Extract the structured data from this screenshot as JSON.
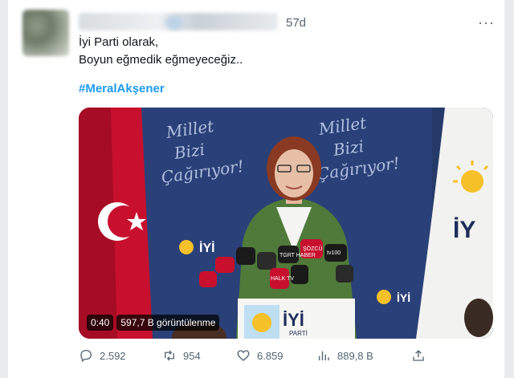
{
  "tweet": {
    "time": "57d",
    "more_label": "···",
    "lines": [
      "İyi Parti olarak,",
      "Boyun eğmedik eğmeyeceğiz.."
    ],
    "hashtag": "#MeralAkşener"
  },
  "media": {
    "banner_text": "Millet Bizi Çağırıyor!",
    "party_logo_text": "İYİ",
    "party_logo_sub": "PARTİ",
    "duration": "0:40",
    "views_label": "597,7 B görüntülenme",
    "mic_labels": [
      "TGRT HABER",
      "ŞÖZCÜ",
      "tv100",
      "HALK TV"
    ]
  },
  "actions": {
    "replies": "2.592",
    "retweets": "954",
    "likes": "6.859",
    "views": "889,8 B"
  },
  "colors": {
    "accent": "#1d9bf0",
    "secondary_text": "#536471",
    "banner_blue": "#263a6a"
  }
}
